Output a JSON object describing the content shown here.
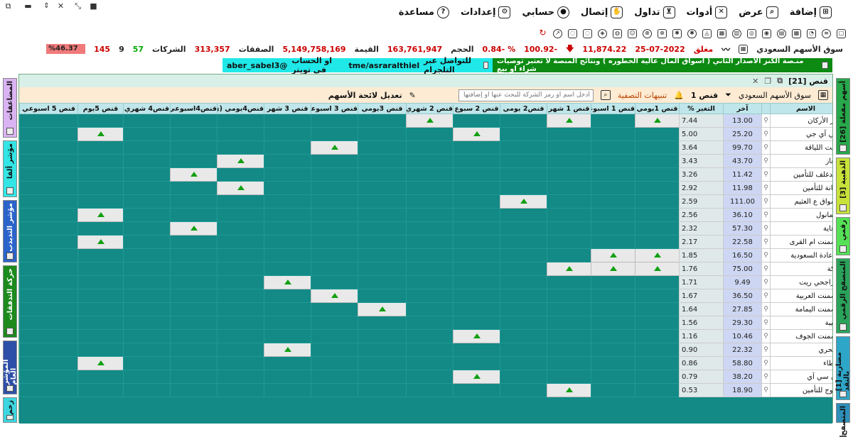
{
  "menu": [
    {
      "name": "add",
      "label": "إضافة",
      "icon": "add-panel-icon"
    },
    {
      "name": "view",
      "label": "عرض",
      "icon": "magnifier-icon"
    },
    {
      "name": "tools",
      "label": "أدوات",
      "icon": "wrench-icon"
    },
    {
      "name": "trade",
      "label": "تداول",
      "icon": "cart-icon"
    },
    {
      "name": "connect",
      "label": "إتصال",
      "icon": "hand-icon"
    },
    {
      "name": "account",
      "label": "حسابي",
      "icon": "user-icon"
    },
    {
      "name": "settings",
      "label": "إعدادات",
      "icon": "gear-icon"
    },
    {
      "name": "help",
      "label": "مساعدة",
      "icon": "question-icon"
    }
  ],
  "status": {
    "market": "سوق الأسهم السعودي",
    "state": "مغلق",
    "date": "25-07-2022",
    "index": "11,874.22",
    "change": "100.92-",
    "change_pct": "0.84- %",
    "volume_label": "الحجم",
    "volume": "163,761,947",
    "value_label": "القيمة",
    "value": "5,149,758,169",
    "trades_label": "الصفقات",
    "trades": "313,357",
    "companies_label": "الشركات",
    "up": "57",
    "unchanged": "9",
    "down": "145",
    "up_ratio": "%46.37",
    "colors": {
      "red": "#cc0000",
      "green": "#00aa00",
      "bar": "#f07a7a"
    }
  },
  "banners": {
    "cyan": {
      "twitter": "aber_sabel3@",
      "text": "او الحساب في تويتر",
      "telegram": "tme/asraralthiel",
      "text2": "للتواصل عبر التلجرام"
    },
    "green": {
      "text": "منـصة الكنز الاصدار الثاني ( أسواق المال عالية الخطوره )  ونتائج المنصة لا تعتبر توصيات شراء او بيع"
    }
  },
  "left_tabs": [
    "المضاعفات",
    "مؤشر ألفا",
    "مؤشر التذبذب",
    "حركة التدفقات",
    "المؤشر العام",
    "زخم"
  ],
  "right_tabs": [
    "[26] أسهم مفعلة",
    "[3] الذهبية",
    "رقمي",
    "المتصفح الرقمي",
    "[1] مضاربة بالنقد",
    "المتصفح"
  ],
  "panel": {
    "title": "قنص [21]",
    "filter_label": "قنص 1",
    "market_select": "سوق الأسهم السعودي",
    "alerts_label": "تنبيهات التصفية",
    "search_placeholder": "ادخل اسم أو رمز الشركة للبحث عنها أو إضافتها",
    "edit_list": "تعديل لائحة الأسهم"
  },
  "columns": [
    "الاسم",
    "",
    "آخر",
    "التغير %",
    "قنص 1يومي",
    "قنص 1 اسبوعي",
    "قنص 1 شهر",
    "قنص2 يومي",
    "قنص 2 سبوع",
    "قنص 2 شهري",
    "قنص 3يومي",
    "قنص 3 اسبوعي",
    "قنص 3 شهر",
    "قنص4يومي (ي",
    "قنص4اسبوعي",
    "قنص4 شهري",
    "قنص 5يوم",
    "قنص 5 اسبوعي"
  ],
  "rows": [
    {
      "name": "دار الأركان",
      "last": "13.00",
      "chg": "7.44",
      "sig": [
        1,
        0,
        1,
        0,
        0,
        1,
        0,
        0,
        0,
        0,
        0,
        0,
        0,
        0
      ]
    },
    {
      "name": "جي آي جي",
      "last": "25.20",
      "chg": "5.00",
      "sig": [
        0,
        0,
        0,
        0,
        1,
        0,
        0,
        0,
        0,
        0,
        0,
        0,
        1,
        0
      ]
    },
    {
      "name": "وفت اللياقة",
      "last": "99.70",
      "chg": "3.64",
      "sig": [
        0,
        0,
        0,
        0,
        0,
        0,
        0,
        1,
        0,
        0,
        0,
        0,
        0,
        0
      ]
    },
    {
      "name": "الغاز",
      "last": "43.70",
      "chg": "3.43",
      "sig": [
        0,
        0,
        0,
        0,
        0,
        0,
        0,
        0,
        0,
        1,
        0,
        0,
        0,
        0
      ]
    },
    {
      "name": "ميدغلف للتأمين",
      "last": "11.42",
      "chg": "3.26",
      "sig": [
        0,
        0,
        0,
        0,
        0,
        0,
        0,
        0,
        0,
        0,
        1,
        0,
        0,
        0
      ]
    },
    {
      "name": "أمانة للتأمين",
      "last": "11.98",
      "chg": "2.92",
      "sig": [
        0,
        0,
        0,
        0,
        0,
        0,
        0,
        0,
        0,
        1,
        0,
        0,
        0,
        0
      ]
    },
    {
      "name": "أسواق ع العثيم",
      "last": "111.00",
      "chg": "2.59",
      "sig": [
        0,
        0,
        0,
        1,
        0,
        0,
        0,
        0,
        0,
        0,
        0,
        0,
        0,
        0
      ]
    },
    {
      "name": "كيمانول",
      "last": "36.10",
      "chg": "2.56",
      "sig": [
        0,
        0,
        0,
        0,
        0,
        0,
        0,
        0,
        0,
        0,
        0,
        0,
        1,
        0
      ]
    },
    {
      "name": "رعاية",
      "last": "57.30",
      "chg": "2.32",
      "sig": [
        0,
        0,
        0,
        0,
        0,
        0,
        0,
        0,
        0,
        0,
        1,
        0,
        0,
        0
      ]
    },
    {
      "name": "اسمنت ام القرى",
      "last": "22.58",
      "chg": "2.17",
      "sig": [
        0,
        0,
        0,
        0,
        0,
        0,
        0,
        0,
        0,
        0,
        0,
        0,
        1,
        0
      ]
    },
    {
      "name": "الإعادة السعودية",
      "last": "16.50",
      "chg": "1.85",
      "sig": [
        1,
        1,
        0,
        0,
        0,
        0,
        0,
        0,
        0,
        0,
        0,
        0,
        0,
        0
      ]
    },
    {
      "name": "مكة",
      "last": "75.00",
      "chg": "1.76",
      "sig": [
        1,
        1,
        1,
        0,
        0,
        0,
        0,
        0,
        0,
        0,
        0,
        0,
        0,
        0
      ]
    },
    {
      "name": "الراجحي ريت",
      "last": "9.49",
      "chg": "1.71",
      "sig": [
        0,
        0,
        0,
        0,
        0,
        0,
        0,
        0,
        1,
        0,
        0,
        0,
        0,
        0
      ]
    },
    {
      "name": "اسمنت العربية",
      "last": "36.50",
      "chg": "1.67",
      "sig": [
        0,
        0,
        0,
        0,
        0,
        0,
        0,
        1,
        0,
        0,
        0,
        0,
        0,
        0
      ]
    },
    {
      "name": "اسمنت اليمامة",
      "last": "27.85",
      "chg": "1.64",
      "sig": [
        0,
        0,
        0,
        0,
        0,
        0,
        1,
        0,
        0,
        0,
        0,
        0,
        0,
        0
      ]
    },
    {
      "name": "طيبة",
      "last": "29.30",
      "chg": "1.56",
      "sig": [
        0,
        0,
        0,
        0,
        0,
        0,
        0,
        0,
        0,
        0,
        0,
        0,
        0,
        0
      ]
    },
    {
      "name": "اسمنت الجوف",
      "last": "10.46",
      "chg": "1.16",
      "sig": [
        0,
        0,
        0,
        0,
        1,
        0,
        0,
        0,
        0,
        0,
        0,
        0,
        0,
        0
      ]
    },
    {
      "name": "البحري",
      "last": "22.32",
      "chg": "0.90",
      "sig": [
        0,
        0,
        0,
        0,
        0,
        0,
        0,
        0,
        1,
        0,
        0,
        0,
        0,
        0
      ]
    },
    {
      "name": "عطاء",
      "last": "58.80",
      "chg": "0.86",
      "sig": [
        0,
        0,
        0,
        0,
        0,
        0,
        0,
        0,
        0,
        0,
        0,
        0,
        1,
        0
      ]
    },
    {
      "name": "بي سي آي",
      "last": "38.20",
      "chg": "0.79",
      "sig": [
        0,
        0,
        0,
        0,
        1,
        0,
        0,
        0,
        0,
        0,
        0,
        0,
        0,
        0
      ]
    },
    {
      "name": "بروج للتأمين",
      "last": "18.90",
      "chg": "0.53",
      "sig": [
        0,
        0,
        1,
        0,
        0,
        0,
        0,
        0,
        0,
        0,
        0,
        0,
        0,
        0
      ]
    }
  ]
}
